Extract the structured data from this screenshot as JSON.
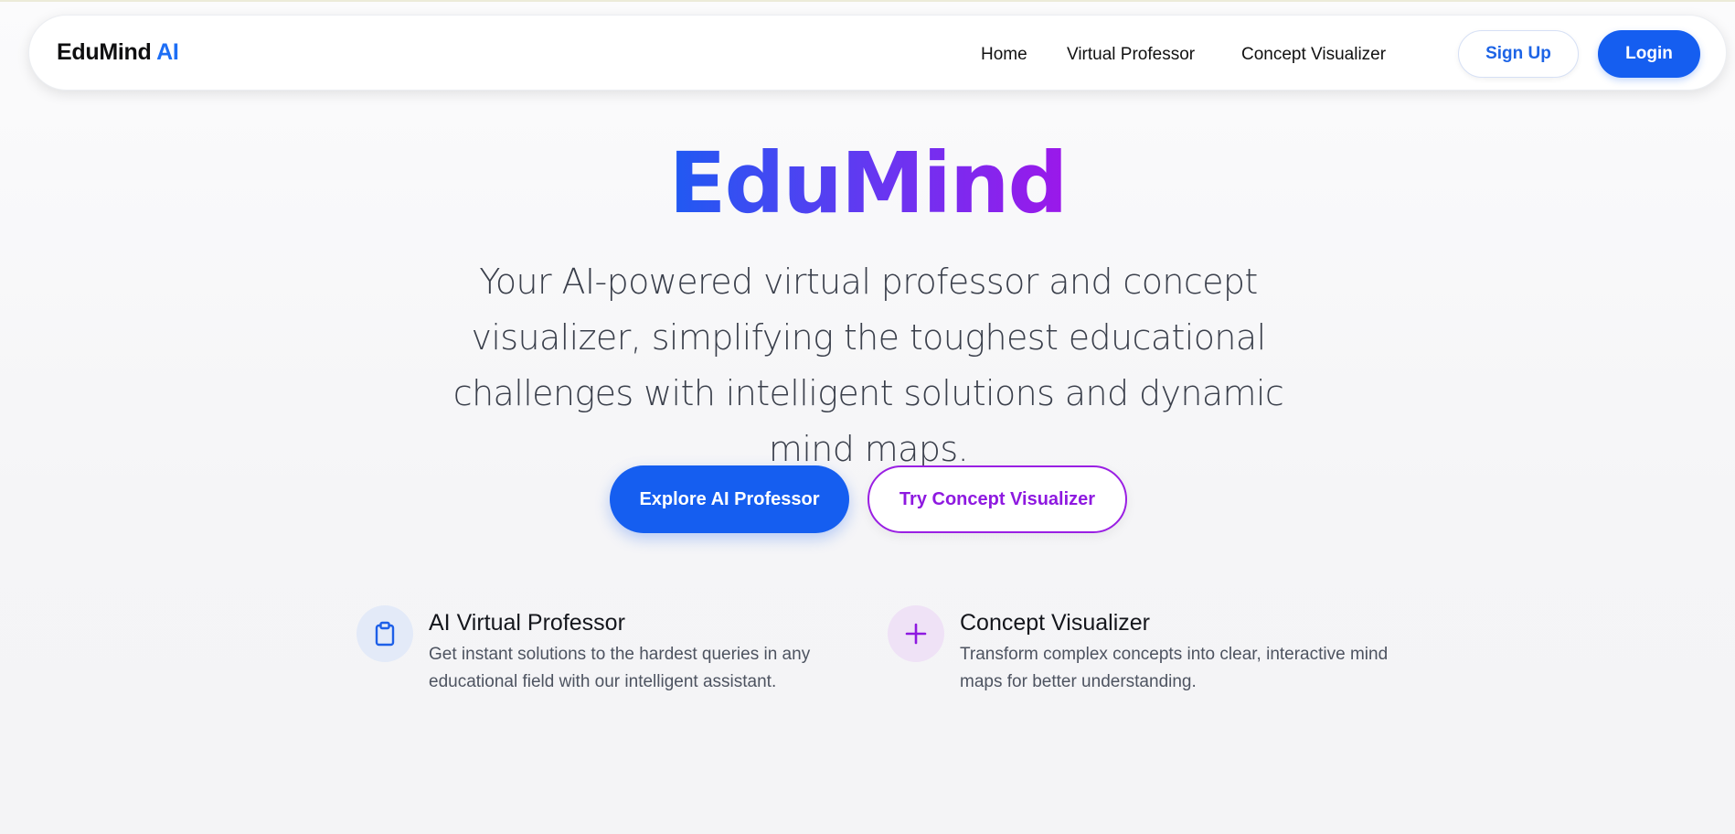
{
  "brand": {
    "name": "EduMind",
    "suffix": "AI"
  },
  "nav": {
    "links": [
      "Home",
      "Virtual Professor",
      "Concept Visualizer"
    ],
    "signup_label": "Sign Up",
    "login_label": "Login"
  },
  "hero": {
    "title": "EduMind",
    "subtitle": "Your AI-powered virtual professor and concept visualizer, simplifying the toughest educational challenges with intelligent solutions and dynamic mind maps.",
    "primary_cta": "Explore AI Professor",
    "secondary_cta": "Try Concept Visualizer"
  },
  "features": [
    {
      "icon": "clipboard-icon",
      "title": "AI Virtual Professor",
      "description": "Get instant solutions to the hardest queries in any educational field with our intelligent assistant."
    },
    {
      "icon": "plus-icon",
      "title": "Concept Visualizer",
      "description": "Transform complex concepts into clear, interactive mind maps for better understanding."
    }
  ],
  "colors": {
    "primary": "#155ef0",
    "brand_accent": "#1d6ef5",
    "gradient_start": "#1f5af2",
    "gradient_end": "#9b18ea",
    "secondary": "#8e19e0"
  }
}
